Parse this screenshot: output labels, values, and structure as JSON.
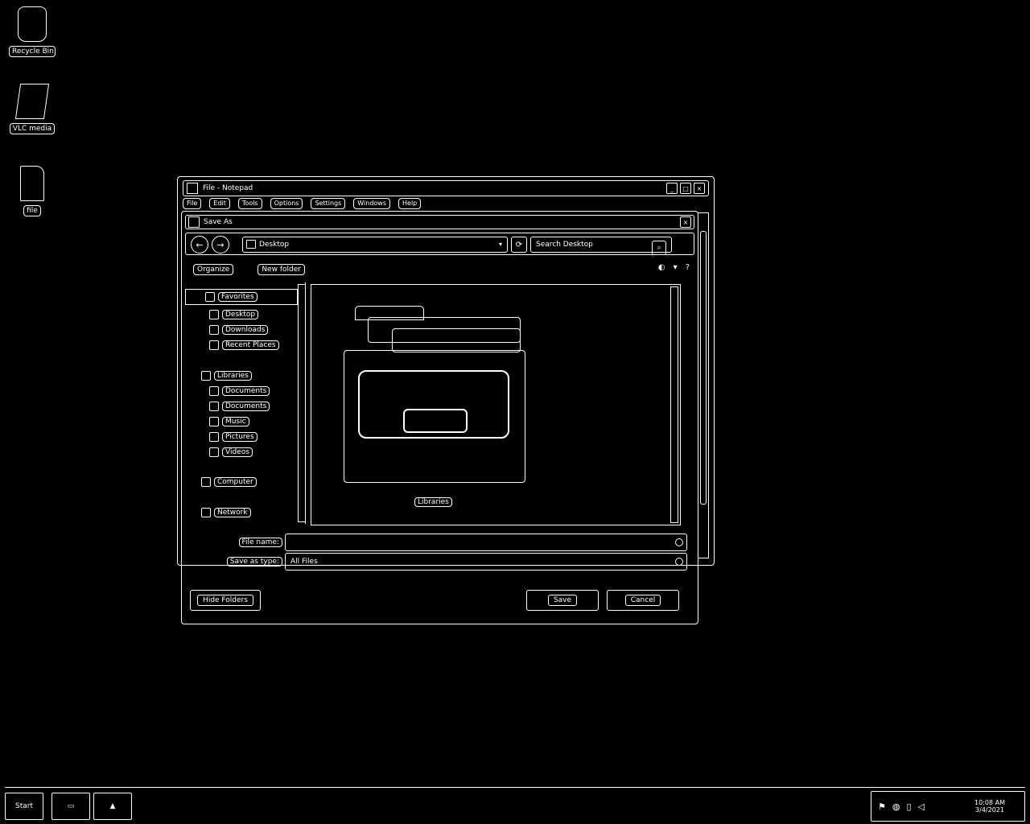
{
  "desktop": {
    "icons": [
      {
        "label": "Recycle Bin"
      },
      {
        "label": "VLC media"
      },
      {
        "label": "file"
      }
    ]
  },
  "back_window": {
    "title": "File - Notepad",
    "menu": [
      "File",
      "Edit",
      "Tools",
      "Options",
      "Settings",
      "Windows",
      "Help"
    ]
  },
  "dialog": {
    "title": "Save As",
    "location": "Desktop",
    "search_placeholder": "Search Desktop",
    "toolbar": {
      "organize": "Organize",
      "new_folder": "New folder"
    },
    "nav": {
      "favorites": "Favorites",
      "fav_items": [
        "Desktop",
        "Downloads",
        "Recent Places"
      ],
      "libraries": "Libraries",
      "lib_items": [
        "Documents",
        "Documents",
        "Music",
        "Pictures",
        "Videos"
      ],
      "computer": "Computer",
      "network": "Network"
    },
    "folder_label": "Libraries",
    "file_name_label": "File name:",
    "file_name_value": "",
    "save_type_label": "Save as type:",
    "save_type_value": "All Files",
    "hide_folders": "Hide Folders",
    "save_button": "Save",
    "cancel_button": "Cancel"
  },
  "taskbar": {
    "start": "Start",
    "clock_time": "10:08 AM",
    "clock_date": "3/4/2021"
  }
}
